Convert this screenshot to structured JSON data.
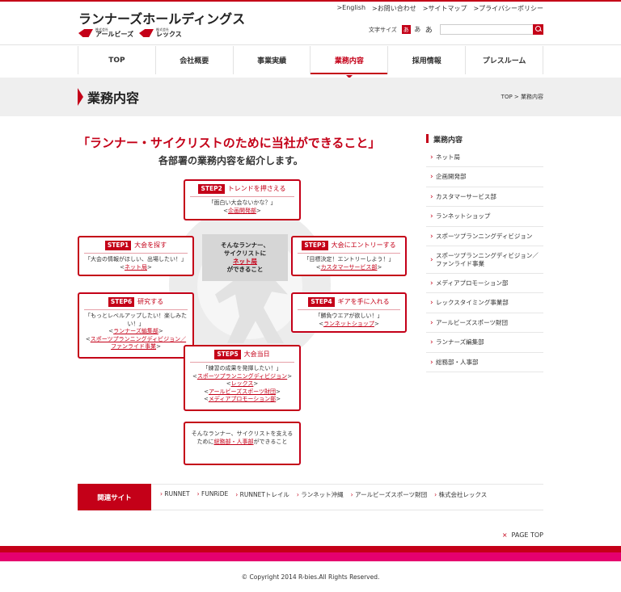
{
  "header": {
    "site_title": "ランナーズホールディングス",
    "brand1_small": "株式会社",
    "brand1_name": "アールビーズ",
    "brand2_small": "株式会社",
    "brand2_name": "レックス",
    "top_links": [
      ">English",
      ">お問い合わせ",
      ">サイトマップ",
      ">プライバシーポリシー"
    ],
    "text_size_label": "文字サイズ",
    "text_sizes": [
      "あ",
      "あ",
      "あ"
    ],
    "search_placeholder": ""
  },
  "nav": [
    "TOP",
    "会社概要",
    "事業実績",
    "業務内容",
    "採用情報",
    "プレスルーム"
  ],
  "page": {
    "title": "業務内容",
    "breadcrumb": "TOP > 業務内容"
  },
  "headline": {
    "main": "「ランナー・サイクリストのために当社ができること」",
    "sub": "各部署の業務内容を紹介します。"
  },
  "diagram": {
    "center_lines": [
      "そんなランナー、",
      "サイクリストに"
    ],
    "center_link": "ネット局",
    "center_tail": "ができること",
    "step2": {
      "step": "STEP2",
      "title": "トレンドを押さえる",
      "quote": "「面白い大会ないかな？」",
      "link": "企画開発部"
    },
    "step1": {
      "step": "STEP1",
      "title": "大会を探す",
      "quote": "「大会の情報がほしい、出場したい！」",
      "link": "ネット局"
    },
    "step3": {
      "step": "STEP3",
      "title": "大会にエントリーする",
      "quote": "「目標決定！エントリーしよう！」",
      "link": "カスタマーサービス部"
    },
    "step6": {
      "step": "STEP6",
      "title": "研究する",
      "quote1": "「もっとレベルアップしたい！楽しみたい！」",
      "link1": "ランナーズ編集部",
      "link2a": "スポーツプランニングディビジョン／",
      "link2b": "ファンライド事業"
    },
    "step4": {
      "step": "STEP4",
      "title": "ギアを手に入れる",
      "quote": "「勝負ウエアが欲しい！」",
      "link": "ランネットショップ"
    },
    "step5": {
      "step": "STEP5",
      "title": "大会当日",
      "quote": "「練習の成果を発揮したい！」",
      "links": [
        "スポーツプランニングディビジョン",
        "レックス",
        "アールビーズスポーツ財団",
        "メディアプロモーション部"
      ]
    },
    "final": {
      "pre": "そんなランナー、サイクリストを支えるために",
      "link": "総務部・人事部",
      "post": "ができること"
    }
  },
  "sidebar": {
    "title": "業務内容",
    "items": [
      "ネット局",
      "企画開発部",
      "カスタマーサービス部",
      "ランネットショップ",
      "スポーツプランニングディビジョン",
      "スポーツプランニングディビジョン／ファンライド事業",
      "メディアプロモーション部",
      "レックスタイミング事業部",
      "アールビーズスポーツ財団",
      "ランナーズ編集部",
      "総務部・人事部"
    ]
  },
  "related": {
    "label": "関連サイト",
    "links": [
      "RUNNET",
      "FUNRiDE",
      "RUNNETトレイル",
      "ランネット沖縄",
      "アールビーズスポーツ財団",
      "株式会社レックス"
    ]
  },
  "pagetop": {
    "mark": "×",
    "label": "PAGE TOP"
  },
  "footer": {
    "copyright": "© Copyright 2014 R-bies.All Rights Reserved."
  },
  "colors": {
    "accent": "#c40018",
    "pink": "#e5006e"
  }
}
